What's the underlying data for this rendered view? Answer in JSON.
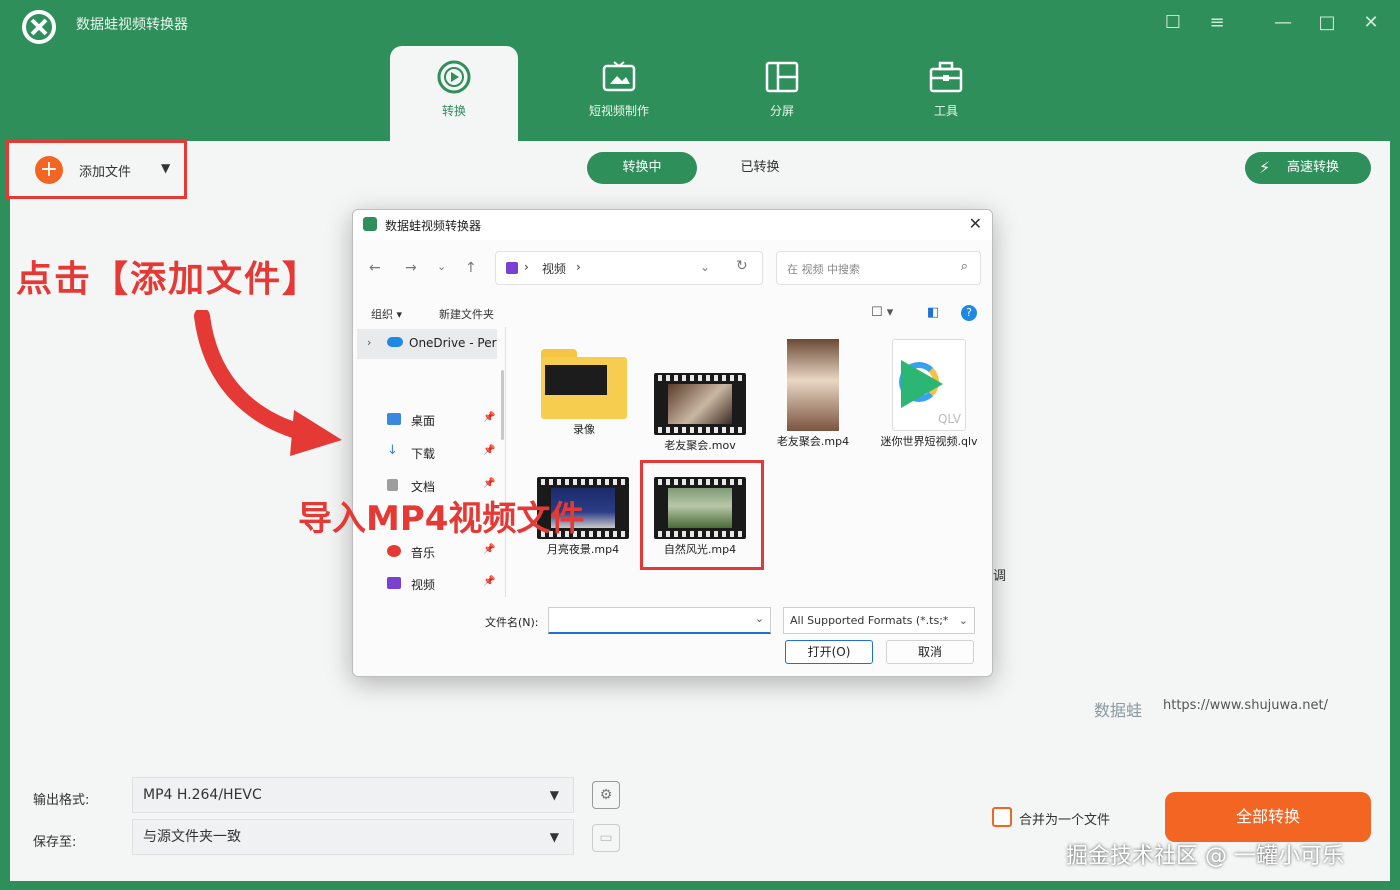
{
  "app": {
    "title": "数据蛙视频转换器",
    "window_controls": [
      "feedback-icon",
      "menu-icon",
      "minimize-icon",
      "maximize-icon",
      "close-icon"
    ]
  },
  "tabs": [
    {
      "label": "转换",
      "icon": "convert-icon",
      "active": true
    },
    {
      "label": "短视频制作",
      "icon": "short-video-icon",
      "active": false
    },
    {
      "label": "分屏",
      "icon": "split-screen-icon",
      "active": false
    },
    {
      "label": "工具",
      "icon": "toolbox-icon",
      "active": false
    }
  ],
  "toolbar": {
    "add_file": "添加文件",
    "converting": "转换中",
    "converted": "已转换",
    "fast_convert": "高速转换"
  },
  "annotations": {
    "click_add": "点击【添加文件】",
    "import_mp4": "导入MP4视频文件"
  },
  "side_note": "调",
  "brand": {
    "mark": "数据蛙",
    "url": "https://www.shujuwa.net/"
  },
  "bottom": {
    "output_format_label": "输出格式:",
    "output_format_value": "MP4 H.264/HEVC",
    "save_to_label": "保存至:",
    "save_to_value": "与源文件夹一致",
    "merge_label": "合并为一个文件",
    "convert_all": "全部转换"
  },
  "watermark": "掘金技术社区 @ 一罐小可乐",
  "dialog": {
    "title": "数据蛙视频转换器",
    "address_path": "视频",
    "search_placeholder": "在 视频 中搜索",
    "organize": "组织 ▾",
    "new_folder": "新建文件夹",
    "nav_onedrive": "OneDrive - Per",
    "nav_items": [
      {
        "label": "桌面",
        "icon": "desktop-icon",
        "color": "#3a86e0"
      },
      {
        "label": "下载",
        "icon": "download-icon",
        "color": "#3a86e0"
      },
      {
        "label": "文档",
        "icon": "document-icon",
        "color": "#9e9e9e"
      },
      {
        "label": "音乐",
        "icon": "music-icon",
        "color": "#e53935"
      },
      {
        "label": "视频",
        "icon": "video-icon",
        "color": "#7b3fd1"
      }
    ],
    "files": [
      {
        "name": "录像",
        "kind": "folder"
      },
      {
        "name": "老友聚会.mov",
        "kind": "video"
      },
      {
        "name": "老友聚会.mp4",
        "kind": "photo"
      },
      {
        "name": "迷你世界短视频.qlv",
        "kind": "qlv"
      },
      {
        "name": "月亮夜景.mp4",
        "kind": "video"
      },
      {
        "name": "自然风光.mp4",
        "kind": "video"
      }
    ],
    "filename_label": "文件名(N):",
    "filename_value": "",
    "format_value": "All Supported Formats (*.ts;*",
    "open": "打开(O)",
    "cancel": "取消",
    "qlv_ext": "QLV"
  }
}
